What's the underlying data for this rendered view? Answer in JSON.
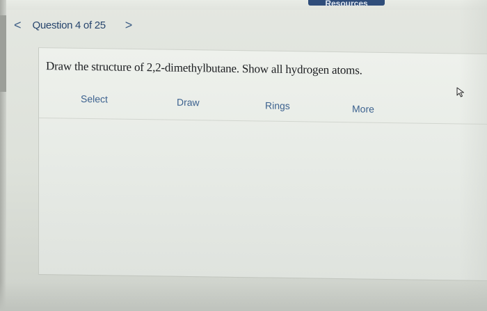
{
  "header": {
    "resources_label": "Resources"
  },
  "nav": {
    "prev_glyph": "<",
    "question_label": "Question 4 of 25",
    "next_glyph": ">"
  },
  "question": {
    "prompt": "Draw the structure of 2,2-dimethylbutane. Show all hydrogen atoms."
  },
  "toolbar": {
    "items": [
      {
        "label": "Select"
      },
      {
        "label": "Draw"
      },
      {
        "label": "Rings"
      },
      {
        "label": "More"
      }
    ]
  },
  "icons": {
    "cursor": "mouse-pointer-icon"
  },
  "colors": {
    "link_blue": "#3d628f",
    "nav_text": "#27456d",
    "resources_bg": "#2f4d7a"
  }
}
